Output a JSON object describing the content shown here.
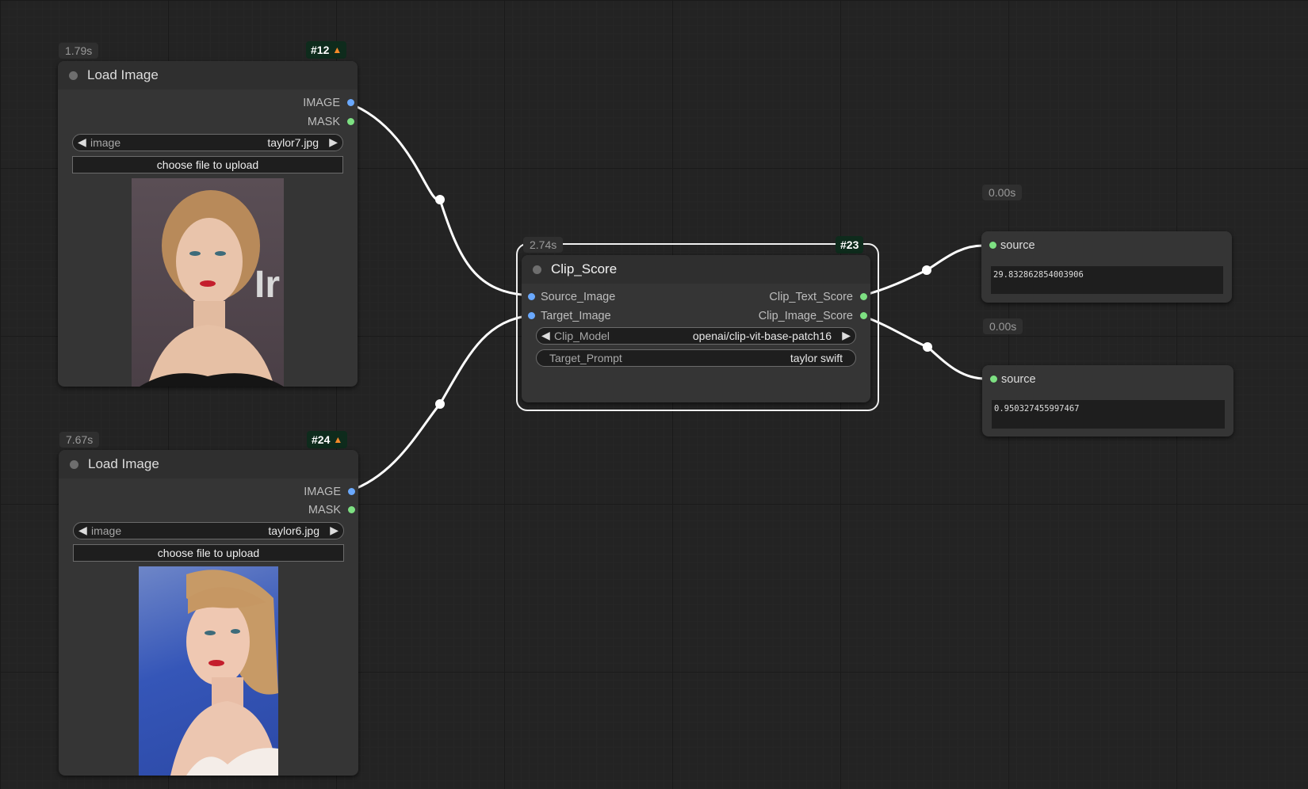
{
  "colors": {
    "canvas": "#232323",
    "node_body": "#353535",
    "node_header": "#2f2f2f",
    "port_image": "#6aa9ff",
    "port_float": "#7de082",
    "link": "#ffffff",
    "id_badge": "#0e2b1c"
  },
  "nodes": {
    "load_image_12": {
      "time": "1.79s",
      "id": "#12",
      "title": "Load Image",
      "outputs": [
        "IMAGE",
        "MASK"
      ],
      "combo_label": "image",
      "combo_value": "taylor7.jpg",
      "upload_label": "choose file to upload"
    },
    "load_image_24": {
      "time": "7.67s",
      "id": "#24",
      "title": "Load Image",
      "outputs": [
        "IMAGE",
        "MASK"
      ],
      "combo_label": "image",
      "combo_value": "taylor6.jpg",
      "upload_label": "choose file to upload"
    },
    "clip_score_23": {
      "time": "2.74s",
      "id": "#23",
      "title": "Clip_Score",
      "inputs": [
        "Source_Image",
        "Target_Image"
      ],
      "outputs": [
        "Clip_Text_Score",
        "Clip_Image_Score"
      ],
      "model_label": "Clip_Model",
      "model_value": "openai/clip-vit-base-patch16",
      "prompt_label": "Target_Prompt",
      "prompt_value": "taylor swift"
    },
    "display_text_score": {
      "time": "0.00s",
      "input": "source",
      "value": "29.832862854003906"
    },
    "display_image_score": {
      "time": "0.00s",
      "input": "source",
      "value": "0.950327455997467"
    }
  }
}
